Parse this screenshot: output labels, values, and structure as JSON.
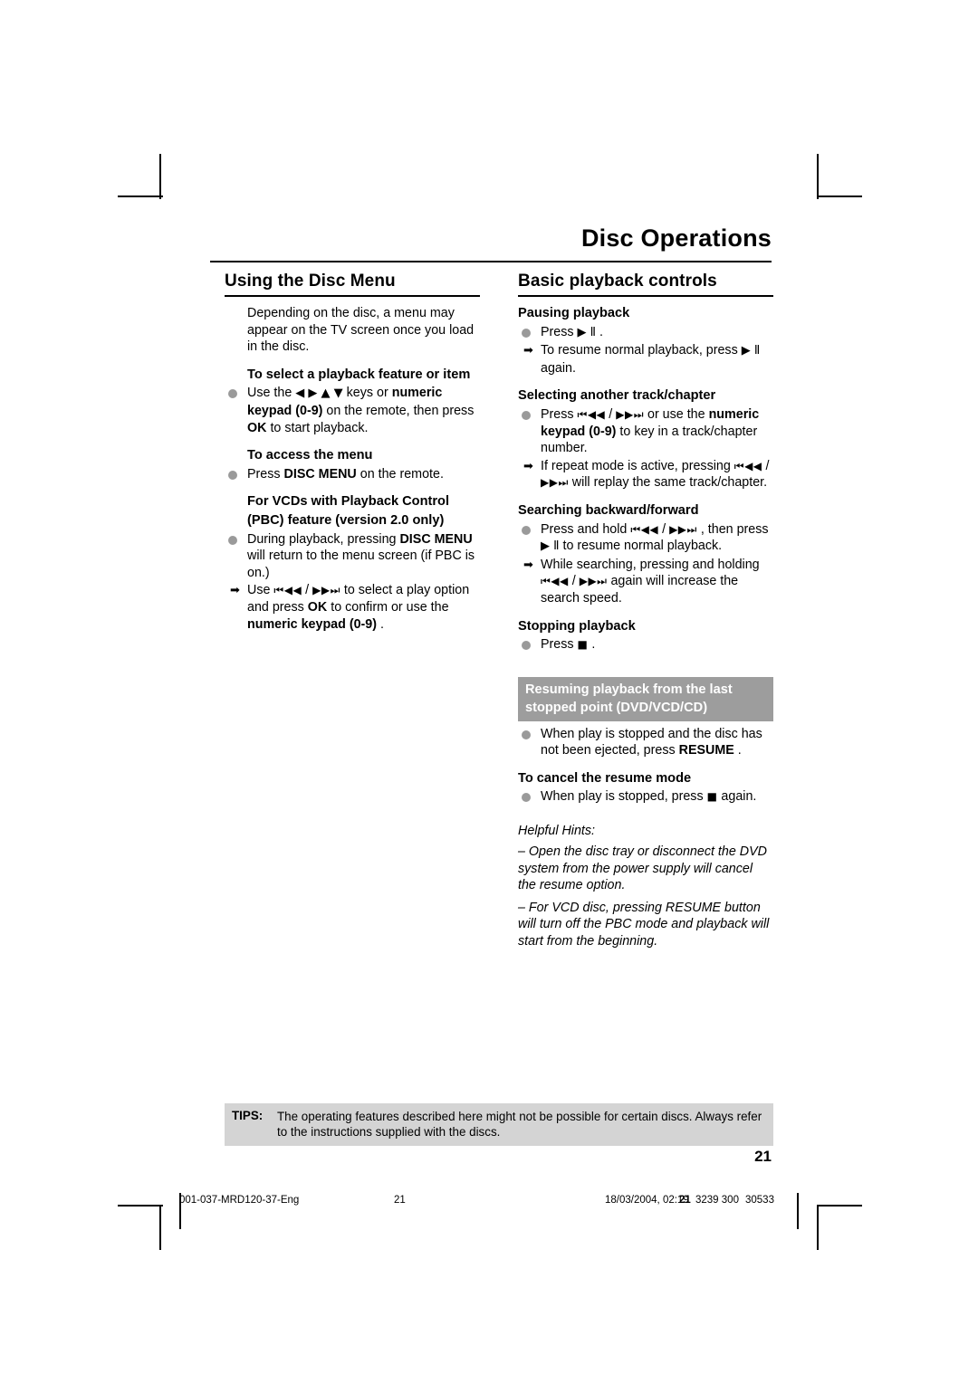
{
  "header": {
    "title": "Disc Operations"
  },
  "left_column": {
    "section_title": "Using the Disc Menu",
    "intro": "Depending on the disc, a menu may appear on the TV screen once you load in the disc.",
    "sub1": {
      "heading": "To select a playback feature or item",
      "bullet_a": "Use the",
      "bullet_keys": "◀ ▶ ▲ ▼",
      "bullet_b": "keys or",
      "bullet_bold1": "numeric keypad (0-9)",
      "bullet_c": "on the remote, then press",
      "bullet_bold2": "OK",
      "bullet_d": "to start playback."
    },
    "sub2": {
      "heading": "To access the menu",
      "bullet_a": "Press",
      "bullet_bold": "DISC MENU",
      "bullet_b": "on the remote."
    },
    "sub3": {
      "heading_line1": "For VCDs with Playback Control",
      "heading_line2": "(PBC) feature (version 2.0 only)",
      "bullet_a": "During playback, pressing",
      "bullet_bold1": "DISC MENU",
      "bullet_b": "will return to the menu screen (if PBC is on.)",
      "arrow_a": "Use",
      "arrow_sym1": "⏮◀◀",
      "arrow_slash": "/",
      "arrow_sym2": "▶▶⏭",
      "arrow_b": "to select a play option and press",
      "arrow_bold1": "OK",
      "arrow_c": "to confirm or use the",
      "arrow_bold2": "numeric keypad (0-9)",
      "arrow_d": "."
    }
  },
  "right_column": {
    "section_title": "Basic playback controls",
    "pausing": {
      "heading": "Pausing playback",
      "bullet_a": "Press",
      "bullet_sym": "▶ Ⅱ",
      "bullet_b": ".",
      "arrow_a": "To resume normal playback, press",
      "arrow_sym": "▶ Ⅱ",
      "arrow_b": "again."
    },
    "selecting": {
      "heading": "Selecting another track/chapter",
      "bullet_a": "Press",
      "bullet_sym1": "⏮◀◀",
      "bullet_slash": "/",
      "bullet_sym2": "▶▶⏭",
      "bullet_b": "or use the",
      "bullet_bold": "numeric keypad (0-9)",
      "bullet_c": "to key in a track/chapter number.",
      "arrow_a": "If repeat mode is active, pressing",
      "arrow_sym1": "⏮◀◀",
      "arrow_slash": "/",
      "arrow_sym2": "▶▶⏭",
      "arrow_b": "will replay the same track/chapter."
    },
    "searching": {
      "heading": "Searching backward/forward",
      "bullet_a": "Press and hold",
      "bullet_sym1": "⏮◀◀",
      "bullet_slash": "/",
      "bullet_sym2": "▶▶⏭",
      "bullet_b": ", then press",
      "bullet_sym3": "▶ Ⅱ",
      "bullet_c": "to resume normal playback.",
      "arrow_a": "While searching, pressing and holding",
      "arrow_sym1": "⏮◀◀",
      "arrow_slash": "/",
      "arrow_sym2": "▶▶⏭",
      "arrow_b": "again will increase the search speed."
    },
    "stopping": {
      "heading": "Stopping playback",
      "bullet_a": "Press",
      "bullet_sym": "■",
      "bullet_b": "."
    },
    "resume_banner_line1": "Resuming playback from the last",
    "resume_banner_line2": "stopped point (DVD/VCD/CD)",
    "resume_bullet_a": "When play is stopped and the disc has not been ejected, press",
    "resume_bullet_bold": "RESUME",
    "resume_bullet_b": ".",
    "cancel": {
      "heading": "To cancel the resume mode",
      "bullet_a": "When play is stopped, press",
      "bullet_sym": "■",
      "bullet_b": "again."
    },
    "hints_title": "Helpful Hints:",
    "hint1": "–  Open the disc tray or disconnect the DVD system from the power supply will cancel the resume option.",
    "hint2": "–  For VCD disc, pressing RESUME button will turn off the PBC mode and playback will start from the beginning."
  },
  "tips": {
    "label": "TIPS:",
    "text": "The operating features described here might not be possible for certain discs.  Always refer to the instructions supplied with the discs."
  },
  "page_number": "21",
  "footer": {
    "file": "001-037-MRD120-37-Eng",
    "page": "21",
    "date": "18/03/2004, 02:19",
    "code1": "21",
    "code2": "3239 300",
    "code3": "30533"
  }
}
